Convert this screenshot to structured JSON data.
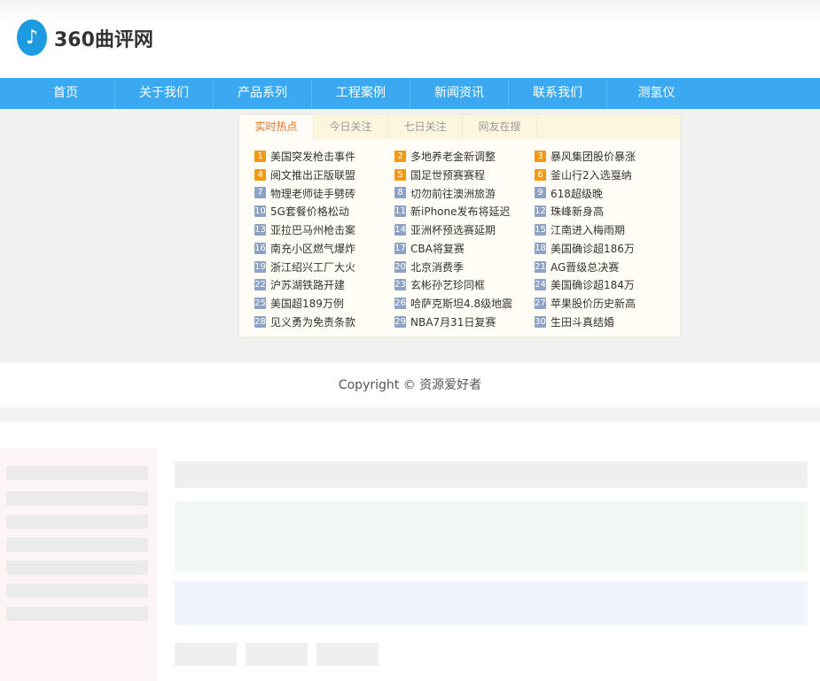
{
  "header": {
    "logo_text": "360曲评网",
    "logo_icon": "music-note-icon"
  },
  "nav": [
    "首页",
    "关于我们",
    "产品系列",
    "工程案例",
    "新闻资讯",
    "联系我们",
    "测氢仪"
  ],
  "hot": {
    "tabs": [
      "实时热点",
      "今日关注",
      "七日关注",
      "网友在搜"
    ],
    "items": [
      "美国突发枪击事件",
      "多地养老金新调整",
      "暴风集团股价暴涨",
      "阅文推出正版联盟",
      "国足世预赛赛程",
      "釜山行2入选戛纳",
      "物理老师徒手劈砖",
      "切勿前往澳洲旅游",
      "618超级晚",
      "5G套餐价格松动",
      "新iPhone发布将延迟",
      "珠峰新身高",
      "亚拉巴马州枪击案",
      "亚洲杯预选赛延期",
      "江南进入梅雨期",
      "南充小区燃气爆炸",
      "CBA将复赛",
      "美国确诊超186万",
      "浙江绍兴工厂大火",
      "北京消费季",
      "AG晋级总决赛",
      "沪苏湖铁路开建",
      "玄彬孙艺珍同框",
      "美国确诊超184万",
      "美国超189万例",
      "哈萨克斯坦4.8级地震",
      "苹果股价历史新高",
      "见义勇为免责条款",
      "NBA7月31日复赛",
      "生田斗真结婚"
    ]
  },
  "footer": {
    "copyright": "Copyright © 资源爱好者"
  }
}
